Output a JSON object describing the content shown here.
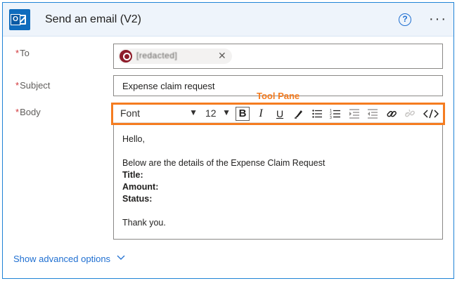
{
  "header": {
    "title": "Send an email (V2)",
    "help_label": "?",
    "more_label": "···"
  },
  "to": {
    "label": "To",
    "required_mark": "*",
    "recipient": "[redacted]",
    "remove_label": "✕"
  },
  "subject": {
    "label": "Subject",
    "required_mark": "*",
    "value": "Expense claim request"
  },
  "body": {
    "label": "Body",
    "required_mark": "*",
    "toolbar": {
      "font": "Font",
      "size": "12",
      "bold": "B",
      "italic": "I",
      "underline": "U"
    },
    "lines": {
      "greeting": "Hello,",
      "intro": "Below are the details of the Expense Claim Request",
      "title": "Title:",
      "amount": "Amount:",
      "status": "Status:",
      "closing": "Thank you."
    }
  },
  "annotation": {
    "tool_pane": "Tool Pane",
    "color": "#f57c20"
  },
  "footer": {
    "advanced_label": "Show advanced options"
  },
  "colors": {
    "accent": "#1f6fd1",
    "required": "#d13438",
    "header_bg": "#eef4fb"
  },
  "icons": {
    "app": "outlook-icon",
    "help": "help-icon",
    "more": "more-options-icon",
    "chip_avatar": "contact-avatar",
    "close": "close-icon",
    "highlighter": "highlighter-icon",
    "bullets": "bulleted-list-icon",
    "numbered": "numbered-list-icon",
    "indent": "increase-indent-icon",
    "outdent": "decrease-indent-icon",
    "link": "link-icon",
    "unlink": "unlink-icon",
    "code": "code-view-icon",
    "chevron": "chevron-down-icon"
  }
}
